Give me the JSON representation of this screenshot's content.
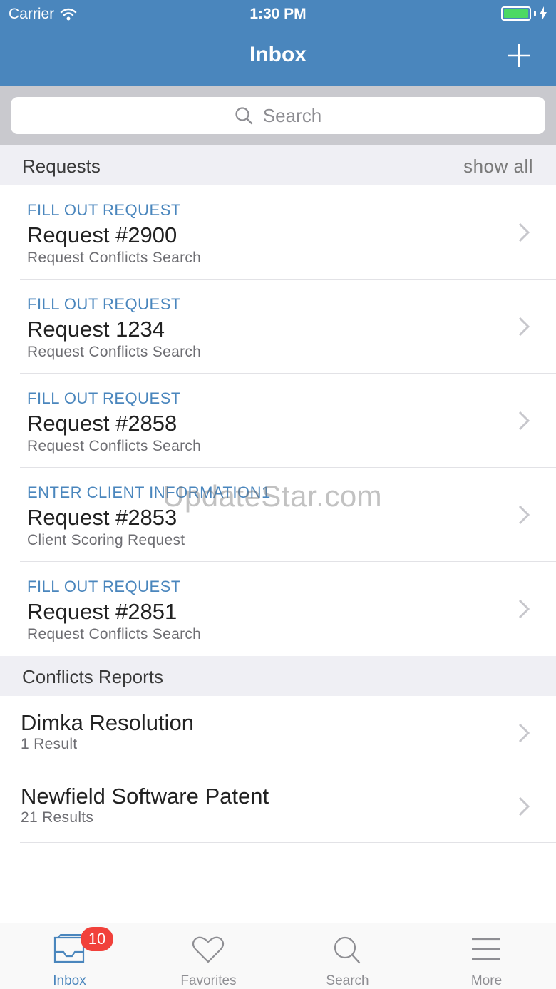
{
  "status_bar": {
    "carrier": "Carrier",
    "time": "1:30 PM"
  },
  "nav": {
    "title": "Inbox"
  },
  "search": {
    "placeholder": "Search"
  },
  "requests_section": {
    "title": "Requests",
    "show_all": "show all",
    "items": [
      {
        "kind": "FILL OUT REQUEST",
        "name": "Request #2900",
        "subtitle": "Request Conflicts Search"
      },
      {
        "kind": "FILL OUT REQUEST",
        "name": "Request 1234",
        "subtitle": "Request Conflicts Search"
      },
      {
        "kind": "FILL OUT REQUEST",
        "name": "Request #2858",
        "subtitle": "Request Conflicts Search"
      },
      {
        "kind": "ENTER CLIENT INFORMATION1",
        "name": "Request #2853",
        "subtitle": "Client Scoring Request"
      },
      {
        "kind": "FILL OUT REQUEST",
        "name": "Request #2851",
        "subtitle": "Request Conflicts Search"
      }
    ]
  },
  "reports_section": {
    "title": "Conflicts Reports",
    "items": [
      {
        "name": "Dimka Resolution",
        "subtitle": "1 Result"
      },
      {
        "name": "Newfield Software Patent",
        "subtitle": "21 Results"
      }
    ]
  },
  "watermark": "UpdateStar.com",
  "tabbar": {
    "inbox": {
      "label": "Inbox",
      "badge": "10"
    },
    "favorites": {
      "label": "Favorites"
    },
    "search": {
      "label": "Search"
    },
    "more": {
      "label": "More"
    }
  },
  "colors": {
    "nav_blue": "#4a86bd",
    "badge_red": "#f1413b",
    "battery_green": "#4cd964"
  }
}
